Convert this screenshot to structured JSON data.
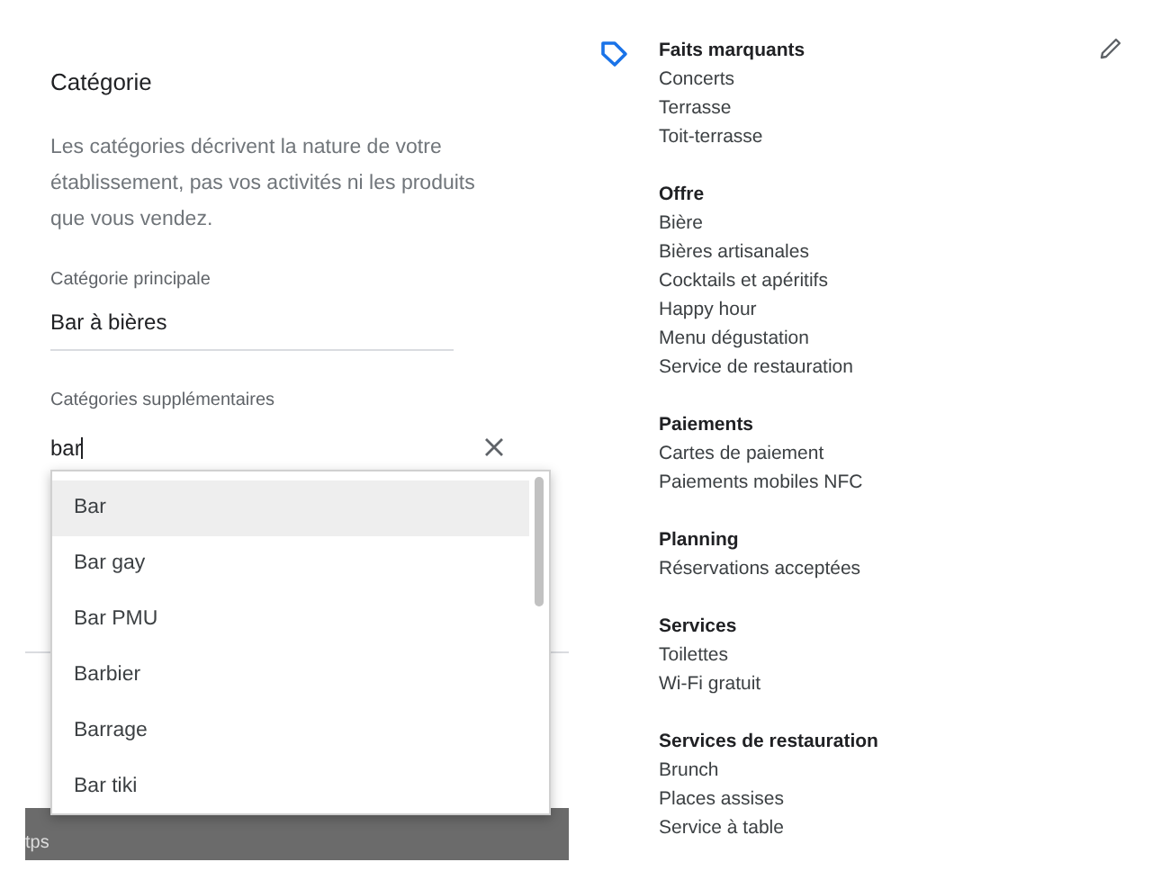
{
  "category_panel": {
    "title": "Catégorie",
    "description": "Les catégories décrivent la nature de votre établissement, pas vos activités ni les produits que vous vendez.",
    "primary": {
      "label": "Catégorie principale",
      "value": "Bar à bières"
    },
    "additional": {
      "label": "Catégories supplémentaires",
      "value": "bar"
    },
    "suggestions": [
      {
        "label": "Bar",
        "selected": true
      },
      {
        "label": "Bar gay",
        "selected": false
      },
      {
        "label": "Bar PMU",
        "selected": false
      },
      {
        "label": "Barbier",
        "selected": false
      },
      {
        "label": "Barrage",
        "selected": false
      },
      {
        "label": "Bar tiki",
        "selected": false
      }
    ],
    "background_bar_text": "tps"
  },
  "attributes": [
    {
      "heading": "Faits marquants",
      "items": [
        "Concerts",
        "Terrasse",
        "Toit-terrasse"
      ]
    },
    {
      "heading": "Offre",
      "items": [
        "Bière",
        "Bières artisanales",
        "Cocktails et apéritifs",
        "Happy hour",
        "Menu dégustation",
        "Service de restauration"
      ]
    },
    {
      "heading": "Paiements",
      "items": [
        "Cartes de paiement",
        "Paiements mobiles NFC"
      ]
    },
    {
      "heading": "Planning",
      "items": [
        "Réservations acceptées"
      ]
    },
    {
      "heading": "Services",
      "items": [
        "Toilettes",
        "Wi-Fi gratuit"
      ]
    },
    {
      "heading": "Services de restauration",
      "items": [
        "Brunch",
        "Places assises",
        "Service à table"
      ]
    }
  ]
}
